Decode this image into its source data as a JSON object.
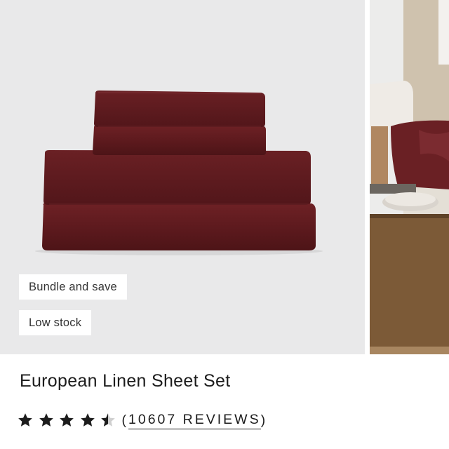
{
  "product": {
    "badges": [
      "Bundle and save",
      "Low stock"
    ],
    "title": "European Linen Sheet Set",
    "rating": {
      "value": 4.5,
      "max": 5,
      "open_paren": "(",
      "count_text": "10607 REVIEWS",
      "close_paren": ")"
    }
  },
  "icons": {
    "star": "star-icon"
  },
  "colors": {
    "linen": "#6b1f22",
    "image_bg": "#e9e9ea",
    "star": "#1c1c1c"
  }
}
